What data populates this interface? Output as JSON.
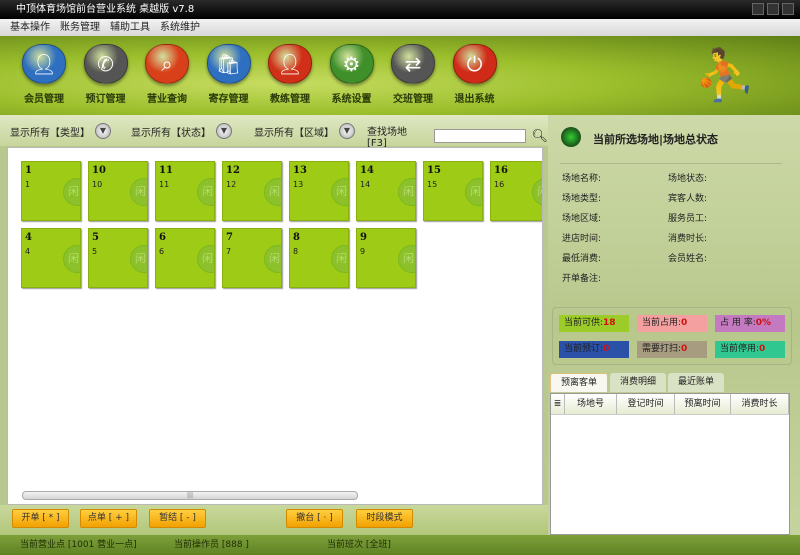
{
  "window": {
    "title": "中顶体育场馆前台营业系统 桌越版 v7.8"
  },
  "menu": [
    "基本操作",
    "账务管理",
    "辅助工具",
    "系统维护"
  ],
  "toolbar": [
    {
      "label": "会员管理",
      "icon": "member-icon",
      "color": "#2f6fc0"
    },
    {
      "label": "预订管理",
      "icon": "phone-icon",
      "color": "#555555"
    },
    {
      "label": "营业查询",
      "icon": "search-icon",
      "color": "#d8401a"
    },
    {
      "label": "寄存管理",
      "icon": "bag-icon",
      "color": "#2f6fc0"
    },
    {
      "label": "教练管理",
      "icon": "coach-icon",
      "color": "#d03018"
    },
    {
      "label": "系统设置",
      "icon": "gear-icon",
      "color": "#3f8f2a"
    },
    {
      "label": "交班管理",
      "icon": "handover-icon",
      "color": "#555555"
    },
    {
      "label": "退出系统",
      "icon": "power-icon",
      "color": "#d02a18"
    }
  ],
  "filters": {
    "type": "显示所有【类型】",
    "state": "显示所有【状态】",
    "area": "显示所有【区域】",
    "search_label": "查找场地 [F3]",
    "search_value": ""
  },
  "venues": [
    {
      "name": "1",
      "sub": "1"
    },
    {
      "name": "10",
      "sub": "10"
    },
    {
      "name": "11",
      "sub": "11"
    },
    {
      "name": "12",
      "sub": "12"
    },
    {
      "name": "13",
      "sub": "13"
    },
    {
      "name": "14",
      "sub": "14"
    },
    {
      "name": "15",
      "sub": "15"
    },
    {
      "name": "16",
      "sub": "16"
    },
    {
      "name": "4",
      "sub": "4"
    },
    {
      "name": "5",
      "sub": "5"
    },
    {
      "name": "6",
      "sub": "6"
    },
    {
      "name": "7",
      "sub": "7"
    },
    {
      "name": "8",
      "sub": "8"
    },
    {
      "name": "9",
      "sub": "9"
    }
  ],
  "actions": [
    "开单 [ * ]",
    "点单 [ + ]",
    "暂结 [ - ]",
    "撤台 [ · ]",
    "时段模式"
  ],
  "status": {
    "point": "当前营业点 [1001 营业一点]",
    "operator": "当前操作员 [888 ]",
    "shift": "当前班次 [全班]"
  },
  "panel": {
    "title": "当前所选场地|场地总状态",
    "fields_left": [
      "场地名称:",
      "场地类型:",
      "场地区域:",
      "进店时间:",
      "最低消费:",
      "开单备注:"
    ],
    "fields_right": [
      "场地状态:",
      "宾客人数:",
      "服务员工:",
      "消费时长:",
      "会员姓名:"
    ],
    "stats": [
      {
        "label": "当前可供:",
        "value": "18",
        "color": "#9ccc2a"
      },
      {
        "label": "当前占用:",
        "value": "0",
        "color": "#f4a0a0"
      },
      {
        "label": "占 用 率:",
        "value": "0%",
        "color": "#c47ac0"
      },
      {
        "label": "当前预订:",
        "value": "0",
        "color": "#2a50a8"
      },
      {
        "label": "需要打扫:",
        "value": "0",
        "color": "#a89c80"
      },
      {
        "label": "当前停用:",
        "value": "0",
        "color": "#30c890"
      }
    ],
    "tabs": [
      "预离客单",
      "消费明细",
      "最近账单"
    ],
    "columns": [
      "场地号",
      "登记时间",
      "预离时间",
      "消费时长"
    ]
  }
}
